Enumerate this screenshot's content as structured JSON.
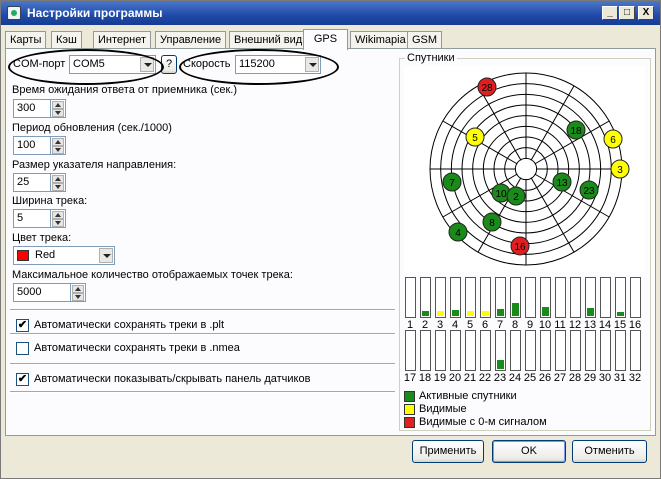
{
  "window": {
    "title": "Настройки программы",
    "minimize": "_",
    "maximize": "□",
    "close": "X"
  },
  "tabs": [
    {
      "label": "Карты"
    },
    {
      "label": "Кэш"
    },
    {
      "label": "Интернет"
    },
    {
      "label": "Управление"
    },
    {
      "label": "Внешний вид"
    },
    {
      "label": "GPS",
      "active": true
    },
    {
      "label": "Wikimapia"
    },
    {
      "label": "GSM"
    }
  ],
  "gps": {
    "com_port_label": "COM-порт",
    "com_port_value": "COM5",
    "help_button": "?",
    "speed_label": "Скорость",
    "speed_value": "115200",
    "timeout_label": "Время ожидания ответа от приемника (сек.)",
    "timeout_value": "300",
    "refresh_label": "Период обновления (сек./1000)",
    "refresh_value": "100",
    "pointer_size_label": "Размер указателя направления:",
    "pointer_size_value": "25",
    "track_width_label": "Ширина трека:",
    "track_width_value": "5",
    "track_color_label": "Цвет трека:",
    "track_color_value": "Red",
    "track_color_hex": "#ff0000",
    "max_points_label": "Максимальное количество отображаемых точек трека:",
    "max_points_value": "5000",
    "autosave_plt_label": "Автоматически сохранять треки в .plt",
    "autosave_plt_checked": true,
    "autosave_nmea_label": "Автоматически сохранять треки в .nmea",
    "autosave_nmea_checked": false,
    "auto_sensors_label": "Автоматически показывать/скрывать панель датчиков",
    "auto_sensors_checked": true
  },
  "satellites": {
    "group_title": "Спутники",
    "colors": {
      "active": "#1a8a1a",
      "visible": "#ffff00",
      "zero": "#e02020"
    },
    "sky": [
      {
        "id": "28",
        "status": "zero"
      },
      {
        "id": "5",
        "status": "visible"
      },
      {
        "id": "18",
        "status": "active"
      },
      {
        "id": "6",
        "status": "visible"
      },
      {
        "id": "3",
        "status": "visible"
      },
      {
        "id": "7",
        "status": "active"
      },
      {
        "id": "10",
        "status": "active"
      },
      {
        "id": "2",
        "status": "active"
      },
      {
        "id": "13",
        "status": "active"
      },
      {
        "id": "23",
        "status": "active"
      },
      {
        "id": "8",
        "status": "active"
      },
      {
        "id": "4",
        "status": "active"
      },
      {
        "id": "16",
        "status": "zero"
      }
    ],
    "bars_row1": [
      {
        "num": "1",
        "level": 0,
        "status": "none"
      },
      {
        "num": "2",
        "level": 0.12,
        "status": "active"
      },
      {
        "num": "3",
        "level": 0.12,
        "status": "visible"
      },
      {
        "num": "4",
        "level": 0.15,
        "status": "active"
      },
      {
        "num": "5",
        "level": 0.12,
        "status": "visible"
      },
      {
        "num": "6",
        "level": 0.12,
        "status": "visible"
      },
      {
        "num": "7",
        "level": 0.18,
        "status": "active"
      },
      {
        "num": "8",
        "level": 0.33,
        "status": "active"
      },
      {
        "num": "9",
        "level": 0,
        "status": "none"
      },
      {
        "num": "10",
        "level": 0.22,
        "status": "active"
      },
      {
        "num": "11",
        "level": 0,
        "status": "none"
      },
      {
        "num": "12",
        "level": 0,
        "status": "none"
      },
      {
        "num": "13",
        "level": 0.2,
        "status": "active"
      },
      {
        "num": "14",
        "level": 0,
        "status": "none"
      },
      {
        "num": "15",
        "level": 0.1,
        "status": "active"
      },
      {
        "num": "16",
        "level": 0,
        "status": "none"
      }
    ],
    "bars_row2": [
      {
        "num": "17",
        "level": 0,
        "status": "none"
      },
      {
        "num": "18",
        "level": 0,
        "status": "none"
      },
      {
        "num": "19",
        "level": 0,
        "status": "none"
      },
      {
        "num": "20",
        "level": 0,
        "status": "none"
      },
      {
        "num": "21",
        "level": 0,
        "status": "none"
      },
      {
        "num": "22",
        "level": 0,
        "status": "none"
      },
      {
        "num": "23",
        "level": 0.22,
        "status": "active"
      },
      {
        "num": "24",
        "level": 0,
        "status": "none"
      },
      {
        "num": "25",
        "level": 0,
        "status": "none"
      },
      {
        "num": "26",
        "level": 0,
        "status": "none"
      },
      {
        "num": "27",
        "level": 0,
        "status": "none"
      },
      {
        "num": "28",
        "level": 0,
        "status": "none"
      },
      {
        "num": "29",
        "level": 0,
        "status": "none"
      },
      {
        "num": "30",
        "level": 0,
        "status": "none"
      },
      {
        "num": "31",
        "level": 0,
        "status": "none"
      },
      {
        "num": "32",
        "level": 0,
        "status": "none"
      }
    ],
    "legend": [
      {
        "label": "Активные спутники",
        "status": "active"
      },
      {
        "label": "Видимые",
        "status": "visible"
      },
      {
        "label": "Видимые с 0-м сигналом",
        "status": "zero"
      }
    ]
  },
  "buttons": {
    "apply": "Применить",
    "ok": "OK",
    "cancel": "Отменить"
  }
}
